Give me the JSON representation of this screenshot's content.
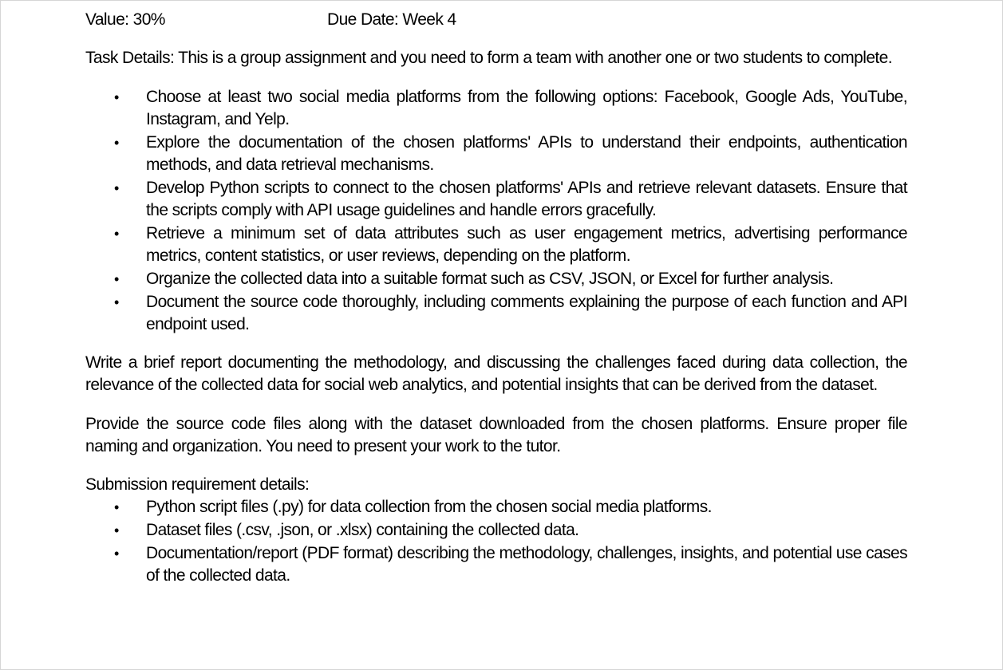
{
  "header": {
    "value": "Value: 30%",
    "due_date": "Due Date: Week 4"
  },
  "task_details": "Task Details: This is a group assignment and you need to form a team with another one or two students to complete.",
  "task_items": [
    "Choose at least two social media platforms from the following options: Facebook, Google Ads, YouTube, Instagram, and Yelp.",
    "Explore the documentation of the chosen platforms' APIs to understand their endpoints, authentication methods, and data retrieval mechanisms.",
    "Develop Python scripts to connect to the chosen platforms' APIs and retrieve relevant datasets. Ensure that the scripts comply with API usage guidelines and handle errors gracefully.",
    "Retrieve a minimum set of data attributes such as user engagement metrics, advertising performance metrics, content statistics, or user reviews, depending on the platform.",
    "Organize the collected data into a suitable format such as CSV, JSON, or Excel for further analysis.",
    "Document the source code thoroughly, including comments explaining the purpose of each function and API endpoint used."
  ],
  "report_paragraph": "Write a brief report documenting the methodology, and discussing the challenges faced during data collection, the relevance of the collected data for social web analytics, and potential insights that can be derived from the dataset.",
  "provide_paragraph": "Provide the source code files along with the dataset downloaded from the chosen platforms. Ensure proper file naming and organization. You need to present your work to the tutor.",
  "submission_heading": "Submission requirement details:",
  "submission_items": [
    "Python script files (.py) for data collection from the chosen social media platforms.",
    "Dataset files (.csv, .json, or .xlsx) containing the collected data.",
    "Documentation/report (PDF format) describing the methodology, challenges, insights, and potential use cases of the collected data."
  ],
  "bullet_glyph": "•"
}
